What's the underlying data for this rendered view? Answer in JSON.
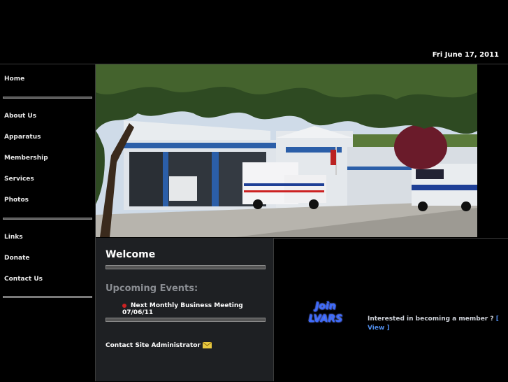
{
  "header": {
    "date": "Fri June 17, 2011"
  },
  "sidebar": {
    "items": [
      {
        "label": "Home"
      },
      {
        "label": "About Us"
      },
      {
        "label": "Apparatus"
      },
      {
        "label": "Membership"
      },
      {
        "label": "Services"
      },
      {
        "label": "Photos"
      },
      {
        "label": "Links"
      },
      {
        "label": "Donate"
      },
      {
        "label": "Contact Us"
      }
    ]
  },
  "welcome": {
    "title": "Welcome",
    "events_title": "Upcoming Events:",
    "event": "Next Monthly Business Meeting 07/06/11",
    "contact": "Contact Site Administrator"
  },
  "join": {
    "logo_line1": "Join",
    "logo_line2": "LVARS",
    "text": "Interested in becoming a member ?",
    "link_open": "[",
    "link_label": "View ]"
  },
  "colors": {
    "accent_link": "#4f8be8",
    "panel": "#1e2023",
    "event_bullet": "#cc2222"
  }
}
